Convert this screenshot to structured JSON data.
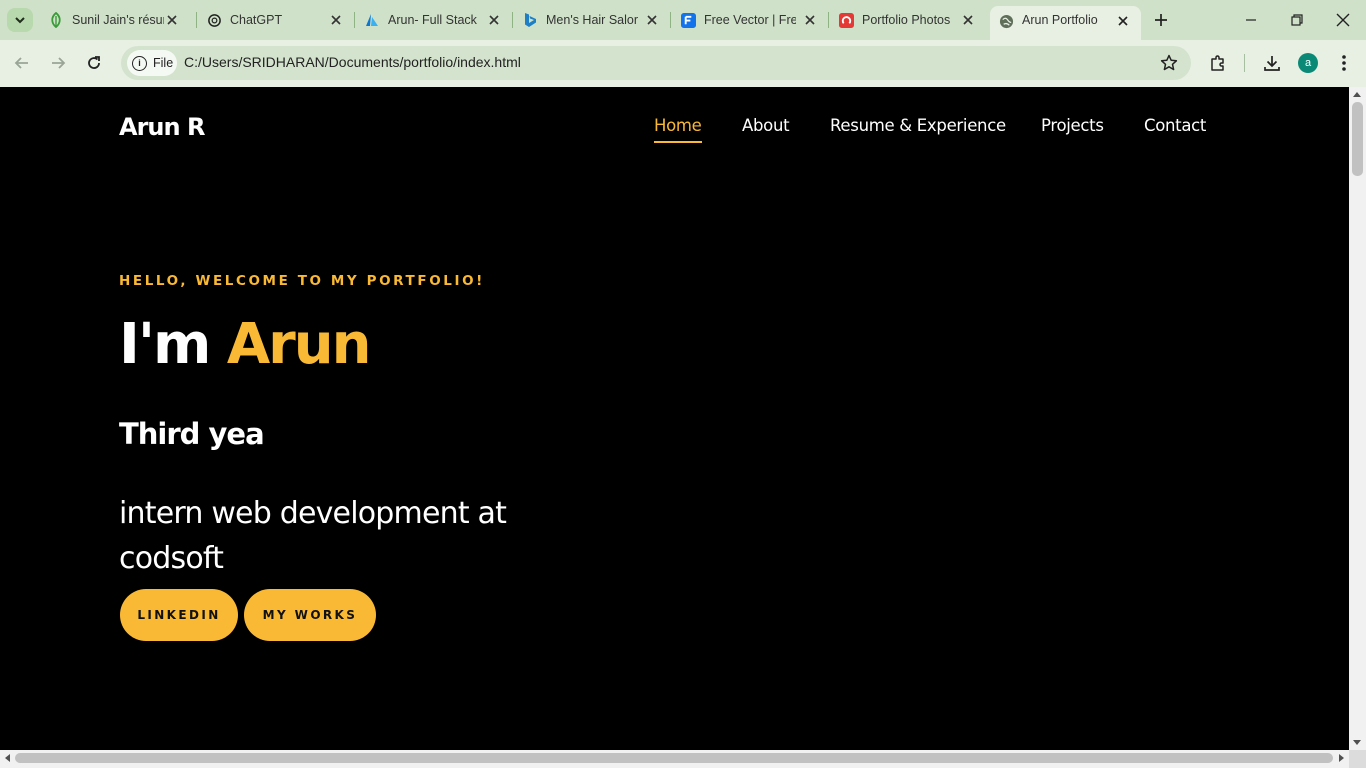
{
  "browser": {
    "tabs": [
      {
        "title": "Sunil Jain's résum",
        "icon": "leaf-icon"
      },
      {
        "title": "ChatGPT",
        "icon": "chatgpt-icon"
      },
      {
        "title": "Arun- Full Stack",
        "icon": "azure-icon"
      },
      {
        "title": "Men's Hair Salor",
        "icon": "bing-icon"
      },
      {
        "title": "Free Vector | Fre",
        "icon": "freepik-icon"
      },
      {
        "title": "Portfolio Photos",
        "icon": "red-app-icon"
      },
      {
        "title": "Arun Portfolio",
        "icon": "globe-icon",
        "active": true
      }
    ],
    "address_chip": "File",
    "url": "C:/Users/SRIDHARAN/Documents/portfolio/index.html",
    "profile_initial": "a"
  },
  "page": {
    "logo": "Arun R",
    "nav": [
      "Home",
      "About",
      "Resume & Experience",
      "Projects",
      "Contact"
    ],
    "active_nav": "Home",
    "hello": "HELLO, WELCOME TO MY PORTFOLIO!",
    "headline_prefix": "I'm",
    "headline_name": "Arun",
    "typed_text": "Third yea",
    "subtitle": "intern web development at codsoft",
    "buttons": [
      "LINKEDIN",
      "MY WORKS"
    ]
  },
  "colors": {
    "accent": "#f9b935",
    "page_background": "#000000",
    "browser_frame": "#cfe1c8",
    "toolbar": "#e8f0e4"
  }
}
